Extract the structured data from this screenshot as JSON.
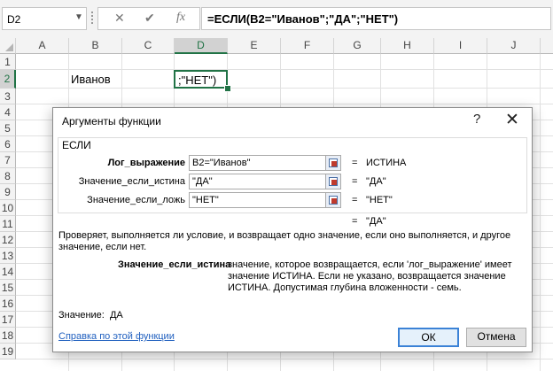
{
  "formula_bar": {
    "name_box": "D2",
    "name_box_arrow": "▼",
    "cancel_icon": "✕",
    "enter_icon": "✔",
    "fx_icon": "fx",
    "formula": "=ЕСЛИ(B2=\"Иванов\";\"ДА\";\"НЕТ\")"
  },
  "grid": {
    "columns": [
      "A",
      "B",
      "C",
      "D",
      "E",
      "F",
      "G",
      "H",
      "I",
      "J"
    ],
    "selected_column": "D",
    "rows": [
      "1",
      "2",
      "3",
      "4",
      "5",
      "6",
      "7",
      "8",
      "9",
      "10",
      "11",
      "12",
      "13",
      "14",
      "15",
      "16",
      "17",
      "18",
      "19"
    ],
    "selected_row": "2",
    "cell_b2": "Иванов",
    "active_cell_d2": ";\"НЕТ\")"
  },
  "dialog": {
    "title": "Аргументы функции",
    "help_icon": "?",
    "close_icon": "✕",
    "function_name": "ЕСЛИ",
    "args": [
      {
        "label": "Лог_выражение",
        "value": "B2=\"Иванов\"",
        "result": "ИСТИНА",
        "bold": true
      },
      {
        "label": "Значение_если_истина",
        "value": "\"ДА\"",
        "result": "\"ДА\"",
        "bold": false
      },
      {
        "label": "Значение_если_ложь",
        "value": "\"НЕТ\"",
        "result": "\"НЕТ\"",
        "bold": false
      }
    ],
    "eq_sign": "=",
    "formula_result": "\"ДА\"",
    "description": "Проверяет, выполняется ли условие, и возвращает одно значение, если оно выполняется, и другое значение, если нет.",
    "current_arg_name": "Значение_если_истина",
    "current_arg_description": "значение, которое возвращается, если 'лог_выражение' имеет значение ИСТИНА. Если не указано, возвращается значение ИСТИНА. Допустимая глубина вложенности - семь.",
    "value_label": "Значение:",
    "value": "ДА",
    "help_link": "Справка по этой функции",
    "ok_label": "ОК",
    "cancel_label": "Отмена"
  },
  "colors": {
    "accent_green": "#217346",
    "link_blue": "#1f5fbf",
    "ok_border": "#3b82d6"
  }
}
